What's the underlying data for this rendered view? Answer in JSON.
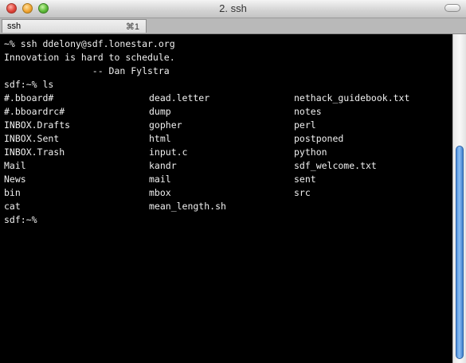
{
  "window": {
    "title": "2. ssh"
  },
  "tab": {
    "label": "ssh",
    "shortcut": "⌘1"
  },
  "terminal": {
    "lines": [
      "~% ssh ddelony@sdf.lonestar.org",
      "Innovation is hard to schedule.",
      "                -- Dan Fylstra",
      "sdf:~% ls"
    ],
    "ls_rows": [
      [
        "#.bboard#",
        "dead.letter",
        "nethack_guidebook.txt"
      ],
      [
        "#.bboardrc#",
        "dump",
        "notes"
      ],
      [
        "INBOX.Drafts",
        "gopher",
        "perl"
      ],
      [
        "INBOX.Sent",
        "html",
        "postponed"
      ],
      [
        "INBOX.Trash",
        "input.c",
        "python"
      ],
      [
        "Mail",
        "kandr",
        "sdf_welcome.txt"
      ],
      [
        "News",
        "mail",
        "sent"
      ],
      [
        "bin",
        "mbox",
        "src"
      ],
      [
        "cat",
        "mean_length.sh",
        ""
      ]
    ],
    "prompt": "sdf:~%"
  },
  "icons": {
    "close": "close-window-icon",
    "minimize": "minimize-window-icon",
    "zoom": "zoom-window-icon",
    "toolbar_toggle": "toolbar-toggle-icon"
  },
  "colors": {
    "background": "#000000",
    "text": "#f0f0f0",
    "scroll_thumb": "#4b8bd8"
  }
}
